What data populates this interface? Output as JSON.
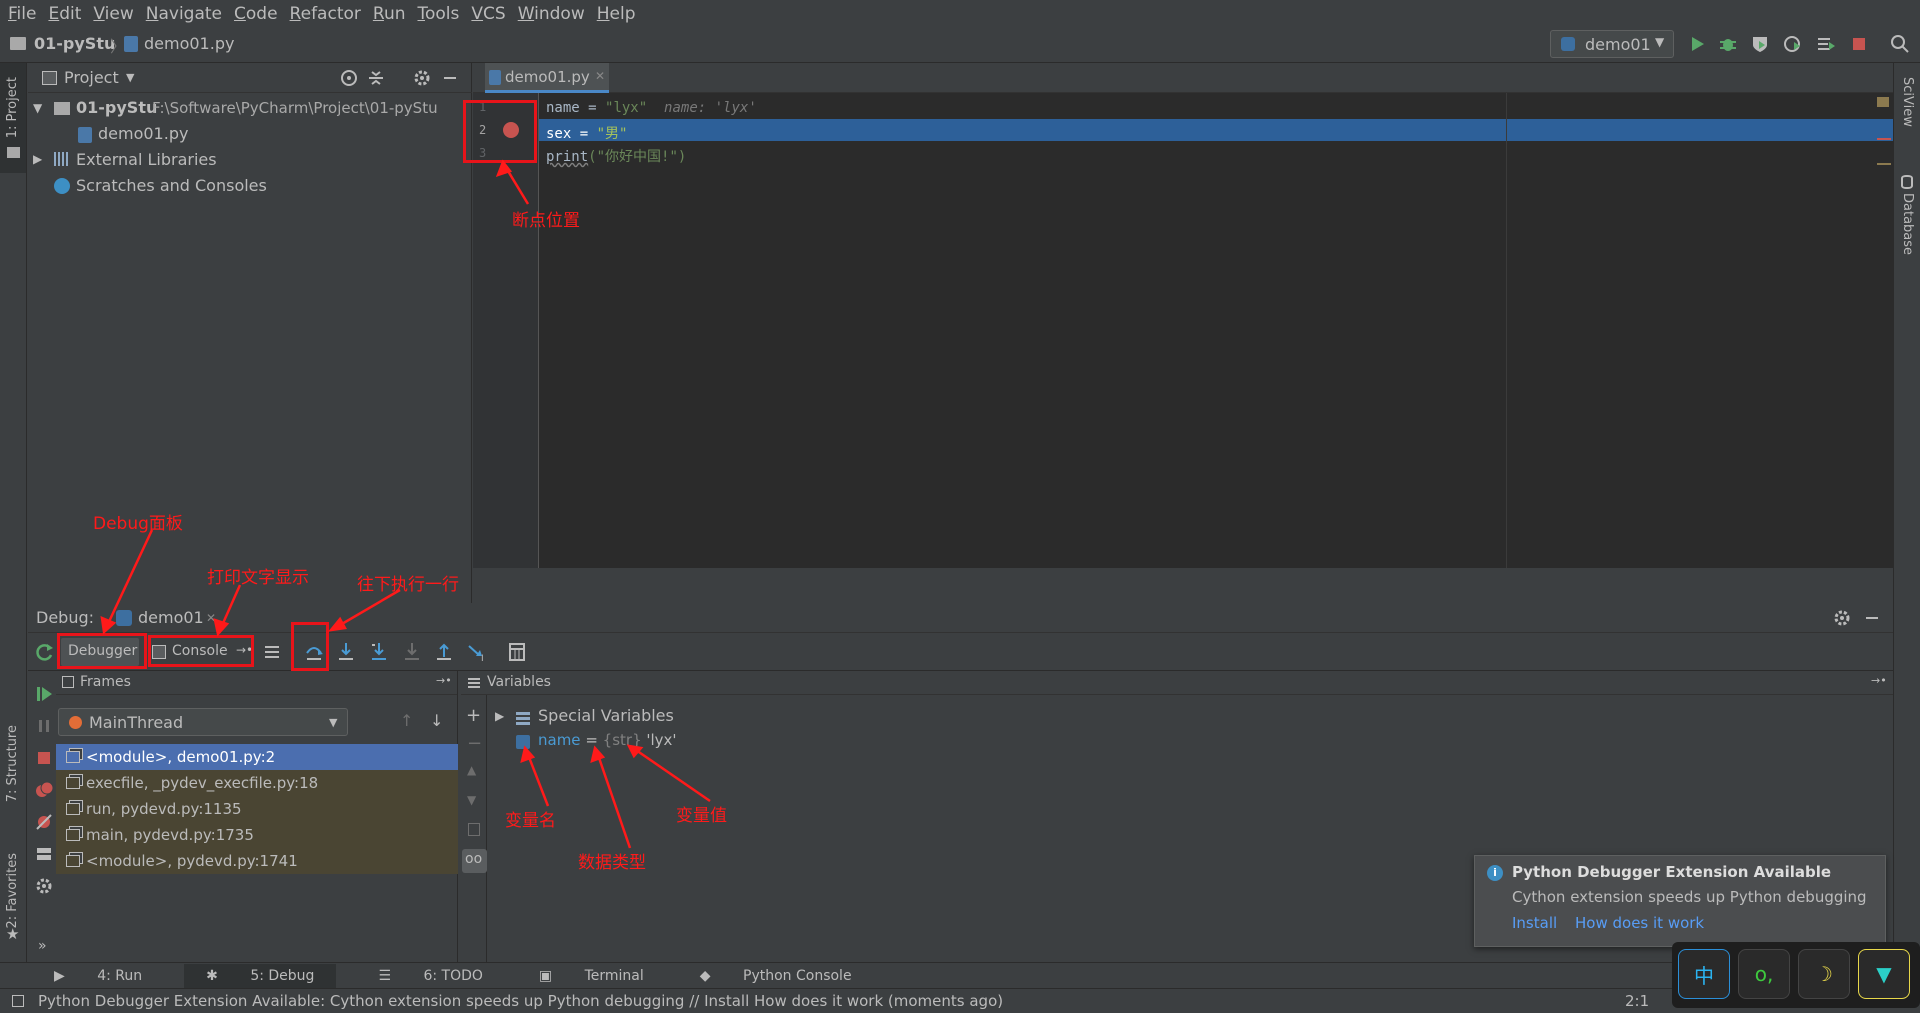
{
  "menu": [
    "File",
    "Edit",
    "View",
    "Navigate",
    "Code",
    "Refactor",
    "Run",
    "Tools",
    "VCS",
    "Window",
    "Help"
  ],
  "nav": {
    "project": "01-pyStu",
    "file": "demo01.py",
    "run_config": "demo01"
  },
  "left_tools": {
    "project": "1: Project",
    "structure": "7: Structure",
    "favorites": "2: Favorites"
  },
  "right_tools": {
    "sciview": "SciView",
    "database": "Database"
  },
  "project_panel": {
    "title": "Project",
    "root": "01-pyStu",
    "root_path": "F:\\Software\\PyCharm\\Project\\01-pyStu",
    "file": "demo01.py",
    "external": "External Libraries",
    "scratches": "Scratches and Consoles"
  },
  "editor": {
    "tab": "demo01.py",
    "lines": [
      {
        "no": "1",
        "code_a": "name = ",
        "code_b": "\"lyx\"",
        "hint": "name: 'lyx'"
      },
      {
        "no": "2",
        "code_a": "sex = ",
        "code_b": "\"男\"",
        "hint": ""
      },
      {
        "no": "3",
        "code_a": "print",
        "code_b": "(\"你好中国!\")",
        "hint": ""
      }
    ]
  },
  "debug": {
    "label": "Debug:",
    "session": "demo01",
    "tab_debugger": "Debugger",
    "tab_console": "Console",
    "frames_title": "Frames",
    "thread": "MainThread",
    "frames": [
      "<module>, demo01.py:2",
      "execfile, _pydev_execfile.py:18",
      "run, pydevd.py:1135",
      "main, pydevd.py:1735",
      "<module>, pydevd.py:1741"
    ],
    "variables_title": "Variables",
    "special": "Special Variables",
    "var_name": "name",
    "var_eq": " = ",
    "var_type": "{str}",
    "var_value": "'lyx'"
  },
  "annotations": {
    "breakpoint": "断点位置",
    "debug_panel": "Debug面板",
    "console_text": "打印文字显示",
    "step_over": "往下执行一行",
    "var_name": "变量名",
    "var_type": "数据类型",
    "var_value": "变量值"
  },
  "notification": {
    "title": "Python Debugger Extension Available",
    "body": "Cython extension speeds up Python debugging",
    "install": "Install",
    "how": "How does it work"
  },
  "bottom_tabs": [
    "4: Run",
    "5: Debug",
    "6: TODO",
    "Terminal",
    "Python Console"
  ],
  "status": {
    "message": "Python Debugger Extension Available: Cython extension speeds up Python debugging // Install How does it work (moments ago)",
    "position": "2:1"
  },
  "ime": {
    "a": "中",
    "b": "o,"
  },
  "colors": {
    "accent": "#4b6eaf",
    "highlight_line": "#2d6099",
    "breakpoint": "#c75450",
    "annotation": "#ff1a1a",
    "string": "#6a8759",
    "run_green": "#59a869"
  }
}
